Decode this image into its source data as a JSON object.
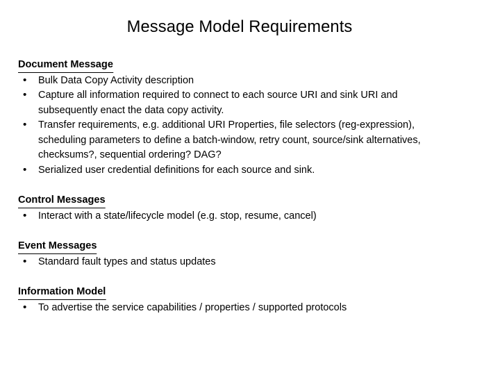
{
  "slide": {
    "title": "Message Model Requirements",
    "bullet_glyph": "•",
    "background_color": "#ffffff",
    "text_color": "#000000",
    "sections": [
      {
        "heading": "Document Message",
        "bullets": [
          {
            "lines": [
              "Bulk Data Copy Activity description"
            ]
          },
          {
            "lines": [
              "Capture all information required to connect to each source URI and sink URI and",
              "subsequently enact the data copy activity."
            ]
          },
          {
            "lines": [
              "Transfer requirements, e.g. additional URI Properties, file selectors (reg-expression),",
              "scheduling parameters to define a batch-window, retry count, source/sink alternatives,",
              "checksums?, sequential ordering? DAG?"
            ]
          },
          {
            "lines": [
              "Serialized user credential definitions for each source and sink."
            ]
          }
        ]
      },
      {
        "heading": "Control Messages",
        "bullets": [
          {
            "lines": [
              "Interact with a state/lifecycle model (e.g. stop, resume, cancel)"
            ]
          }
        ]
      },
      {
        "heading": "Event Messages",
        "bullets": [
          {
            "lines": [
              "Standard fault types and status updates"
            ]
          }
        ]
      },
      {
        "heading": "Information Model",
        "bullets": [
          {
            "lines": [
              "To advertise the service capabilities / properties / supported protocols"
            ]
          }
        ]
      }
    ]
  }
}
